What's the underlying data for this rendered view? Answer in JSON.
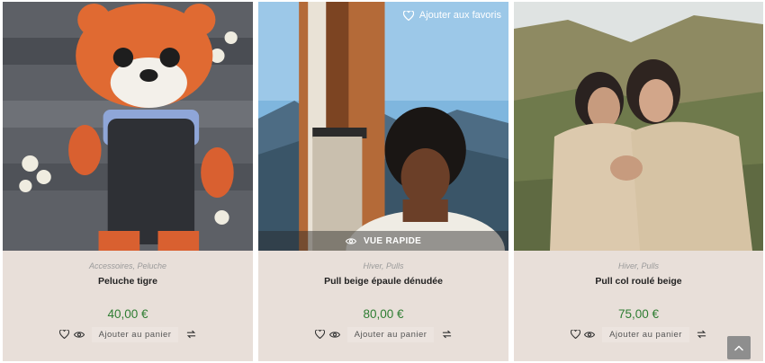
{
  "products": [
    {
      "categories": [
        "Accessoires",
        "Peluche"
      ],
      "title": "Peluche tigre",
      "price": "40,00 €",
      "add_to_cart": "Ajouter au panier"
    },
    {
      "categories": [
        "Hiver",
        "Pulls"
      ],
      "title": "Pull beige épaule dénudée",
      "price": "80,00 €",
      "add_to_cart": "Ajouter au panier",
      "favorite_label": "Ajouter aux favoris",
      "quick_view_label": "VUE RAPIDE"
    },
    {
      "categories": [
        "Hiver",
        "Pulls"
      ],
      "title": "Pull col roulé beige",
      "price": "75,00 €",
      "add_to_cart": "Ajouter au panier"
    }
  ],
  "separator": ", ",
  "colors": {
    "card_background": "#e8dfd9",
    "price": "#2e7d32",
    "scroll_top_button": "#8e8e8e"
  },
  "icons": [
    "heart-icon",
    "eye-icon",
    "compare-arrows-icon",
    "chevron-up-icon"
  ]
}
